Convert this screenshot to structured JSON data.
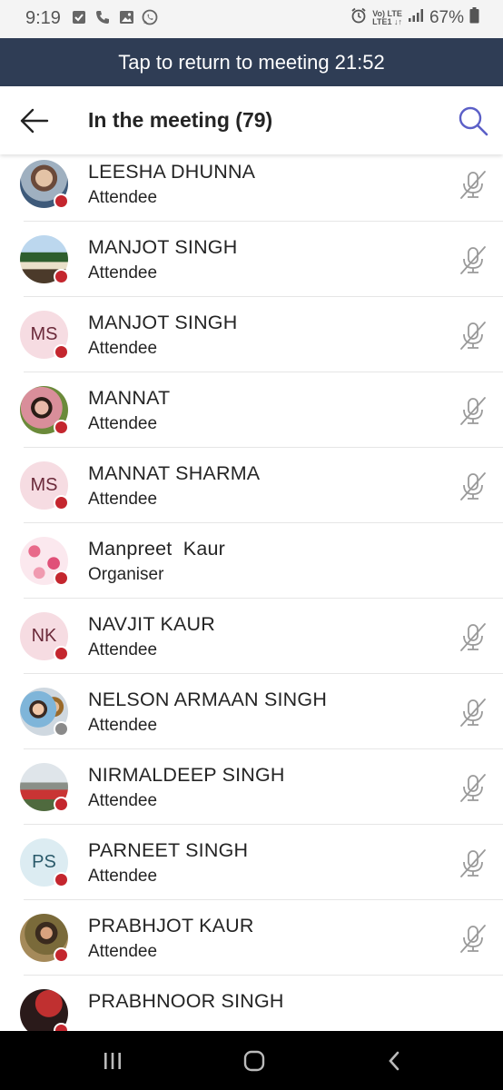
{
  "status": {
    "time": "9:19",
    "battery": "67%",
    "network_top": "Vo) LTE",
    "network_bottom": "LTE1 ↓↑"
  },
  "banner": {
    "text": "Tap to return to meeting",
    "timer": "21:52"
  },
  "header": {
    "title": "In the meeting (79)"
  },
  "colors": {
    "banner_bg": "#2f3d55",
    "accent": "#5b5fc7",
    "presence_busy": "#c4262e",
    "presence_offline": "#8a8a8a"
  },
  "participants": [
    {
      "name": "",
      "role": "Attendee",
      "avatar_type": "photo",
      "presence": "busy",
      "muted": true
    },
    {
      "name": "LEESHA DHUNNA",
      "role": "Attendee",
      "avatar_type": "photo",
      "presence": "busy",
      "muted": true
    },
    {
      "name": "MANJOT SINGH",
      "role": "Attendee",
      "avatar_type": "photo",
      "presence": "busy",
      "muted": true
    },
    {
      "name": "MANJOT SINGH",
      "role": "Attendee",
      "initials": "MS",
      "avatar_type": "initials",
      "presence": "busy",
      "muted": true
    },
    {
      "name": "MANNAT",
      "role": "Attendee",
      "avatar_type": "photo",
      "presence": "busy",
      "muted": true
    },
    {
      "name": "MANNAT SHARMA",
      "role": "Attendee",
      "initials": "MS",
      "avatar_type": "initials",
      "presence": "busy",
      "muted": true
    },
    {
      "name": "Manpreet  Kaur",
      "role": "Organiser",
      "avatar_type": "photo",
      "presence": "busy",
      "muted": false
    },
    {
      "name": "NAVJIT KAUR",
      "role": "Attendee",
      "initials": "NK",
      "avatar_type": "initials",
      "presence": "busy",
      "muted": true
    },
    {
      "name": "NELSON ARMAAN SINGH",
      "role": "Attendee",
      "avatar_type": "photo",
      "presence": "offline",
      "muted": true
    },
    {
      "name": "NIRMALDEEP SINGH",
      "role": "Attendee",
      "avatar_type": "photo",
      "presence": "busy",
      "muted": true
    },
    {
      "name": "PARNEET SINGH",
      "role": "Attendee",
      "initials": "PS",
      "avatar_type": "initials",
      "presence": "busy",
      "muted": true
    },
    {
      "name": "PRABHJOT KAUR",
      "role": "Attendee",
      "avatar_type": "photo",
      "presence": "busy",
      "muted": true
    },
    {
      "name": "PRABHNOOR SINGH",
      "role": "",
      "avatar_type": "photo",
      "presence": "busy",
      "muted": false
    }
  ],
  "icons": {
    "back": "back-arrow-icon",
    "search": "search-icon",
    "mic_off": "mic-off-icon",
    "nav_recents": "recents-icon",
    "nav_home": "home-icon",
    "nav_back": "nav-back-icon"
  }
}
